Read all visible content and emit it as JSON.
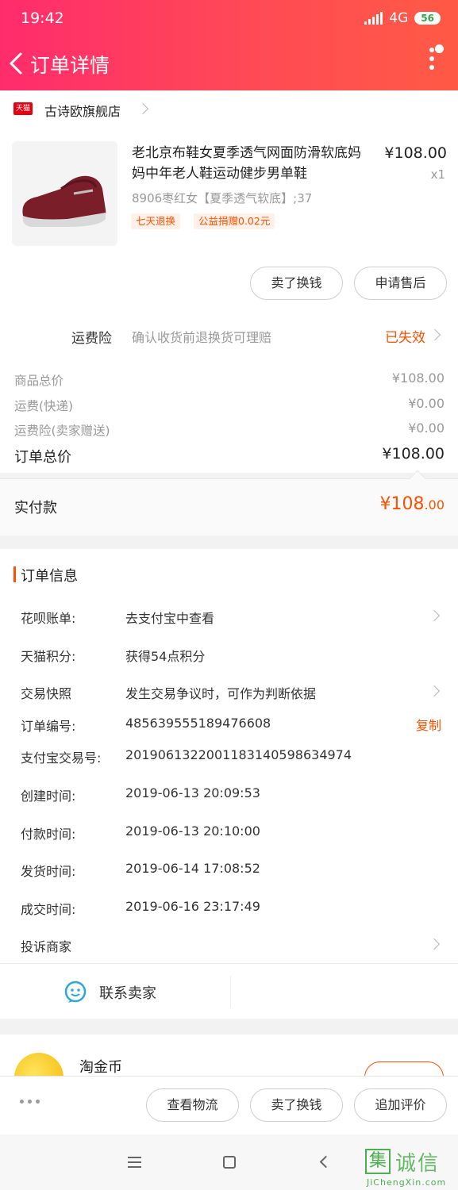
{
  "status_bar": {
    "time": "19:42",
    "network": "4G",
    "battery": "56"
  },
  "header": {
    "title": "订单详情"
  },
  "store": {
    "badge": "天猫",
    "name": "古诗欧旗舰店"
  },
  "product": {
    "name": "老北京布鞋女夏季透气网面防滑软底妈妈中年老人鞋运动健步男单鞋",
    "price": "¥108.00",
    "qty": "x1",
    "sku": "8906枣红女【夏季透气软底】;37",
    "tags": [
      "七天退换",
      "公益捐赠0.02元"
    ],
    "buttons": [
      "卖了换钱",
      "申请售后"
    ]
  },
  "insurance": {
    "label": "运费险",
    "desc": "确认收货前退换货可理赔",
    "status": "已失效"
  },
  "fees": [
    {
      "label": "商品总价",
      "value": "¥108.00"
    },
    {
      "label": "运费(快递)",
      "value": "¥0.00"
    },
    {
      "label": "运费险(卖家赠送)",
      "value": "¥0.00"
    }
  ],
  "total": {
    "label": "订单总价",
    "value": "¥108.00"
  },
  "paid": {
    "label": "实付款",
    "value_main": "¥108",
    "value_cents": ".00"
  },
  "order_info": {
    "title": "订单信息",
    "rows": [
      {
        "label": "花呗账单:",
        "value": "去支付宝中查看"
      },
      {
        "label": "天猫积分:",
        "value": "获得54点积分"
      },
      {
        "label": "交易快照",
        "value": "发生交易争议时，可作为判断依据"
      },
      {
        "label": "订单编号:",
        "value": "485639555189476608"
      },
      {
        "label": "支付宝交易号:",
        "value": "2019061322001183140598634974"
      },
      {
        "label": "创建时间:",
        "value": "2019-06-13 20:09:53"
      },
      {
        "label": "付款时间:",
        "value": "2019-06-13 20:10:00"
      },
      {
        "label": "发货时间:",
        "value": "2019-06-14 17:08:52"
      },
      {
        "label": "成交时间:",
        "value": "2019-06-16 23:17:49"
      },
      {
        "label": "投诉商家",
        "value": ""
      }
    ],
    "copy_label": "复制",
    "contact_label": "联系卖家"
  },
  "coin": {
    "label": "淘金币"
  },
  "action_bar": {
    "buttons": [
      "查看物流",
      "卖了换钱",
      "追加评价"
    ]
  },
  "watermark": {
    "text": "诚信",
    "glyph": "集",
    "url": "JiChengXin.com"
  }
}
